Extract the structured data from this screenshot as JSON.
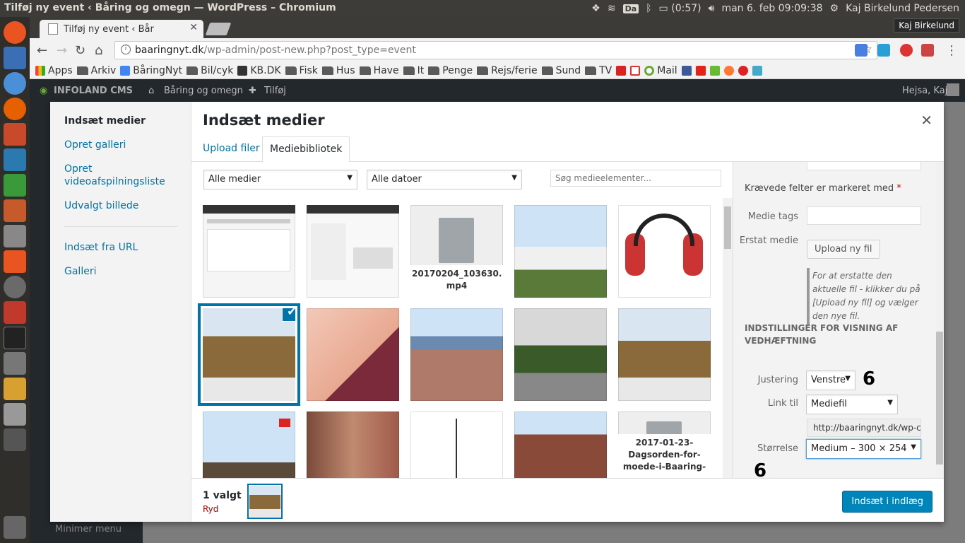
{
  "os": {
    "window_title": "Tilføj ny event ‹ Båring og omegn — WordPress – Chromium",
    "keyboard": "Da",
    "battery": "(0:57)",
    "datetime": "man  6. feb 09:09:38",
    "user": "Kaj Birkelund Pedersen"
  },
  "browser": {
    "tab_title": "Tilføj ny event ‹ Bår",
    "profile": "Kaj Birkelund",
    "url_host": "baaringnyt.dk",
    "url_path": "/wp-admin/post-new.php?post_type=event",
    "bookmarks": [
      "Apps",
      "Arkiv",
      "BåringNyt",
      "Bil/cyk",
      "KB.DK",
      "Fisk",
      "Hus",
      "Have",
      "It",
      "Penge",
      "Rejs/ferie",
      "Sund",
      "TV",
      "Mail"
    ]
  },
  "wp": {
    "cms_name": "INFOLAND CMS",
    "site": "Båring og omegn",
    "add": "Tilføj",
    "greeting": "Hejsa, Kaj",
    "collapse": "Minimer menu"
  },
  "modal": {
    "title": "Indsæt medier",
    "menu": [
      "Indsæt medier",
      "Opret galleri",
      "Opret videoafspilningsliste",
      "Udvalgt billede",
      "Indsæt fra URL",
      "Galleri"
    ],
    "tabs": [
      "Upload filer",
      "Mediebibliotek"
    ],
    "filter_type": "Alle medier",
    "filter_date": "Alle datoer",
    "search_placeholder": "Søg medieelementer...",
    "files": {
      "video": "20170204_103630.\nmp4",
      "doc": "2017-01-23-\nDagsorden-for-\nmoede-i-Baaring-"
    },
    "details": {
      "required_note": "Krævede felter er markeret med",
      "required_star": "*",
      "tags_label": "Medie tags",
      "replace_label": "Erstat medie",
      "upload_new": "Upload ny fil",
      "hint": "For at erstatte den aktuelle fil - klikker du på [Upload ny fil] og vælger den nye fil.",
      "settings_heading": "INDSTILLINGER FOR VISNING AF VEDHÆFTNING",
      "align_label": "Justering",
      "align_value": "Venstre",
      "link_label": "Link til",
      "link_value": "Mediefil",
      "link_url": "http://baaringnyt.dk/wp-cc",
      "size_label": "Størrelse",
      "size_value": "Medium – 300 × 254",
      "annot_1": "6",
      "annot_2": "6"
    },
    "footer": {
      "selected_count": "1 valgt",
      "clear": "Ryd",
      "insert": "Indsæt i indlæg"
    }
  }
}
